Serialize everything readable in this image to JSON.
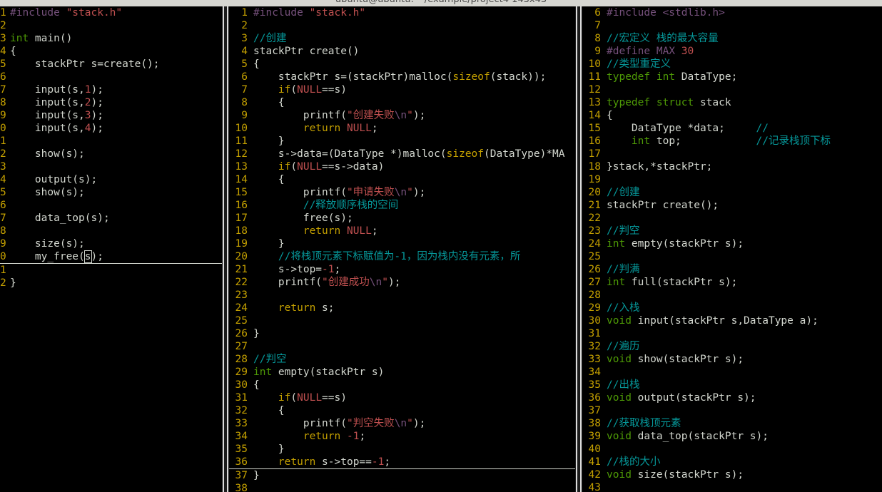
{
  "window": {
    "title": "ubuntu@ubuntu: ~/example/project4 143x43"
  },
  "panes": [
    {
      "id": "left",
      "lines": [
        {
          "n": "1",
          "segs": [
            [
              "pp",
              "#include "
            ],
            [
              "str",
              "\"stack.h\""
            ]
          ]
        },
        {
          "n": "2",
          "segs": []
        },
        {
          "n": "3",
          "segs": [
            [
              "ty",
              "int"
            ],
            [
              "",
              " main()"
            ]
          ]
        },
        {
          "n": "4",
          "segs": [
            [
              "",
              "{"
            ]
          ]
        },
        {
          "n": "5",
          "segs": [
            [
              "",
              "    stackPtr s=create();"
            ]
          ]
        },
        {
          "n": "6",
          "segs": []
        },
        {
          "n": "7",
          "segs": [
            [
              "",
              "    input(s,"
            ],
            [
              "num",
              "1"
            ],
            [
              "",
              ");"
            ]
          ]
        },
        {
          "n": "8",
          "segs": [
            [
              "",
              "    input(s,"
            ],
            [
              "num",
              "2"
            ],
            [
              "",
              ");"
            ]
          ]
        },
        {
          "n": "9",
          "segs": [
            [
              "",
              "    input(s,"
            ],
            [
              "num",
              "3"
            ],
            [
              "",
              ");"
            ]
          ]
        },
        {
          "n": "0",
          "segs": [
            [
              "",
              "    input(s,"
            ],
            [
              "num",
              "4"
            ],
            [
              "",
              ");"
            ]
          ]
        },
        {
          "n": "1",
          "segs": []
        },
        {
          "n": "2",
          "segs": [
            [
              "",
              "    show(s);"
            ]
          ]
        },
        {
          "n": "3",
          "segs": []
        },
        {
          "n": "4",
          "segs": [
            [
              "",
              "    output(s);"
            ]
          ]
        },
        {
          "n": "5",
          "segs": [
            [
              "",
              "    show(s);"
            ]
          ]
        },
        {
          "n": "6",
          "segs": []
        },
        {
          "n": "7",
          "segs": [
            [
              "",
              "    data_top(s);"
            ]
          ]
        },
        {
          "n": "8",
          "segs": []
        },
        {
          "n": "9",
          "segs": [
            [
              "",
              "    size(s);"
            ]
          ]
        },
        {
          "n": "0",
          "cursor": true,
          "segs": [
            [
              "",
              "    my_free("
            ],
            [
              "cur",
              "s"
            ],
            [
              "",
              ");"
            ]
          ]
        },
        {
          "n": "1",
          "segs": []
        },
        {
          "n": "2",
          "segs": [
            [
              "",
              "}"
            ]
          ]
        }
      ]
    },
    {
      "id": "mid",
      "lines": [
        {
          "n": "1",
          "segs": [
            [
              "pp",
              "#include "
            ],
            [
              "str",
              "\"stack.h\""
            ]
          ]
        },
        {
          "n": "2",
          "segs": []
        },
        {
          "n": "3",
          "segs": [
            [
              "cm",
              "//创建"
            ]
          ]
        },
        {
          "n": "4",
          "segs": [
            [
              "",
              "stackPtr create()"
            ]
          ]
        },
        {
          "n": "5",
          "segs": [
            [
              "",
              "{"
            ]
          ]
        },
        {
          "n": "6",
          "segs": [
            [
              "",
              "    stackPtr s=(stackPtr)malloc("
            ],
            [
              "kw",
              "sizeof"
            ],
            [
              "",
              "(stack));"
            ]
          ]
        },
        {
          "n": "7",
          "segs": [
            [
              "",
              "    "
            ],
            [
              "kw",
              "if"
            ],
            [
              "",
              "("
            ],
            [
              "num",
              "NULL"
            ],
            [
              "",
              "==s)"
            ]
          ]
        },
        {
          "n": "8",
          "segs": [
            [
              "",
              "    {"
            ]
          ]
        },
        {
          "n": "9",
          "segs": [
            [
              "",
              "        printf("
            ],
            [
              "str",
              "\"创建失败"
            ],
            [
              "pp",
              "\\n"
            ],
            [
              "str",
              "\""
            ],
            [
              "",
              ");"
            ]
          ]
        },
        {
          "n": "10",
          "segs": [
            [
              "",
              "        "
            ],
            [
              "kw",
              "return"
            ],
            [
              "",
              " "
            ],
            [
              "num",
              "NULL"
            ],
            [
              "",
              ";"
            ]
          ]
        },
        {
          "n": "11",
          "segs": [
            [
              "",
              "    }"
            ]
          ]
        },
        {
          "n": "12",
          "segs": [
            [
              "",
              "    s->data=(DataType *)malloc("
            ],
            [
              "kw",
              "sizeof"
            ],
            [
              "",
              "(DataType)*MA"
            ]
          ]
        },
        {
          "n": "13",
          "segs": [
            [
              "",
              "    "
            ],
            [
              "kw",
              "if"
            ],
            [
              "",
              "("
            ],
            [
              "num",
              "NULL"
            ],
            [
              "",
              "==s->data)"
            ]
          ]
        },
        {
          "n": "14",
          "segs": [
            [
              "",
              "    {"
            ]
          ]
        },
        {
          "n": "15",
          "segs": [
            [
              "",
              "        printf("
            ],
            [
              "str",
              "\"申请失败"
            ],
            [
              "pp",
              "\\n"
            ],
            [
              "str",
              "\""
            ],
            [
              "",
              ");"
            ]
          ]
        },
        {
          "n": "16",
          "segs": [
            [
              "",
              "        "
            ],
            [
              "cm",
              "//释放顺序栈的空间"
            ]
          ]
        },
        {
          "n": "17",
          "segs": [
            [
              "",
              "        free(s);"
            ]
          ]
        },
        {
          "n": "18",
          "segs": [
            [
              "",
              "        "
            ],
            [
              "kw",
              "return"
            ],
            [
              "",
              " "
            ],
            [
              "num",
              "NULL"
            ],
            [
              "",
              ";"
            ]
          ]
        },
        {
          "n": "19",
          "segs": [
            [
              "",
              "    }"
            ]
          ]
        },
        {
          "n": "20",
          "segs": [
            [
              "",
              "    "
            ],
            [
              "cm",
              "//将栈顶元素下标赋值为-1，因为栈内没有元素，所"
            ]
          ]
        },
        {
          "n": "21",
          "segs": [
            [
              "",
              "    s->top="
            ],
            [
              "num",
              "-1"
            ],
            [
              "",
              ";"
            ]
          ]
        },
        {
          "n": "22",
          "segs": [
            [
              "",
              "    printf("
            ],
            [
              "str",
              "\"创建成功"
            ],
            [
              "pp",
              "\\n"
            ],
            [
              "str",
              "\""
            ],
            [
              "",
              ");"
            ]
          ]
        },
        {
          "n": "23",
          "segs": []
        },
        {
          "n": "24",
          "segs": [
            [
              "",
              "    "
            ],
            [
              "kw",
              "return"
            ],
            [
              "",
              " s;"
            ]
          ]
        },
        {
          "n": "25",
          "segs": []
        },
        {
          "n": "26",
          "segs": [
            [
              "",
              "}"
            ]
          ]
        },
        {
          "n": "27",
          "segs": []
        },
        {
          "n": "28",
          "segs": [
            [
              "cm",
              "//判空"
            ]
          ]
        },
        {
          "n": "29",
          "segs": [
            [
              "ty",
              "int"
            ],
            [
              "",
              " empty(stackPtr s)"
            ]
          ]
        },
        {
          "n": "30",
          "segs": [
            [
              "",
              "{"
            ]
          ]
        },
        {
          "n": "31",
          "segs": [
            [
              "",
              "    "
            ],
            [
              "kw",
              "if"
            ],
            [
              "",
              "("
            ],
            [
              "num",
              "NULL"
            ],
            [
              "",
              "==s)"
            ]
          ]
        },
        {
          "n": "32",
          "segs": [
            [
              "",
              "    {"
            ]
          ]
        },
        {
          "n": "33",
          "segs": [
            [
              "",
              "        printf("
            ],
            [
              "str",
              "\"判空失败"
            ],
            [
              "pp",
              "\\n"
            ],
            [
              "str",
              "\""
            ],
            [
              "",
              ");"
            ]
          ]
        },
        {
          "n": "34",
          "segs": [
            [
              "",
              "        "
            ],
            [
              "kw",
              "return"
            ],
            [
              "",
              " "
            ],
            [
              "num",
              "-1"
            ],
            [
              "",
              ";"
            ]
          ]
        },
        {
          "n": "35",
          "segs": [
            [
              "",
              "    }"
            ]
          ]
        },
        {
          "n": "36",
          "cursor": true,
          "segs": [
            [
              "",
              "    "
            ],
            [
              "kw",
              "return"
            ],
            [
              "",
              " s->top=="
            ],
            [
              "num",
              "-1"
            ],
            [
              "",
              ";"
            ]
          ]
        },
        {
          "n": "37",
          "segs": [
            [
              "",
              "}"
            ]
          ]
        },
        {
          "n": "38",
          "segs": []
        }
      ]
    },
    {
      "id": "right",
      "lines": [
        {
          "n": "6",
          "segs": [
            [
              "pp",
              "#include <stdlib.h>"
            ]
          ]
        },
        {
          "n": "7",
          "segs": []
        },
        {
          "n": "8",
          "segs": [
            [
              "cm",
              "//宏定义 栈的最大容量"
            ]
          ]
        },
        {
          "n": "9",
          "segs": [
            [
              "pp",
              "#define MAX "
            ],
            [
              "num",
              "30"
            ]
          ]
        },
        {
          "n": "10",
          "segs": [
            [
              "cm",
              "//类型重定义"
            ]
          ]
        },
        {
          "n": "11",
          "segs": [
            [
              "ty",
              "typedef int"
            ],
            [
              "",
              " DataType;"
            ]
          ]
        },
        {
          "n": "12",
          "segs": []
        },
        {
          "n": "13",
          "segs": [
            [
              "ty",
              "typedef struct"
            ],
            [
              "",
              " stack"
            ]
          ]
        },
        {
          "n": "14",
          "segs": [
            [
              "",
              "{"
            ]
          ]
        },
        {
          "n": "15",
          "segs": [
            [
              "",
              "    DataType *data;     "
            ],
            [
              "cm",
              "//"
            ]
          ]
        },
        {
          "n": "16",
          "segs": [
            [
              "",
              "    "
            ],
            [
              "ty",
              "int"
            ],
            [
              "",
              " top;            "
            ],
            [
              "cm",
              "//记录栈顶下标"
            ]
          ]
        },
        {
          "n": "17",
          "segs": []
        },
        {
          "n": "18",
          "segs": [
            [
              "",
              "}stack,*stackPtr;"
            ]
          ]
        },
        {
          "n": "19",
          "segs": []
        },
        {
          "n": "20",
          "segs": [
            [
              "cm",
              "//创建"
            ]
          ]
        },
        {
          "n": "21",
          "segs": [
            [
              "",
              "stackPtr create();"
            ]
          ]
        },
        {
          "n": "22",
          "segs": []
        },
        {
          "n": "23",
          "segs": [
            [
              "cm",
              "//判空"
            ]
          ]
        },
        {
          "n": "24",
          "segs": [
            [
              "ty",
              "int"
            ],
            [
              "",
              " empty(stackPtr s);"
            ]
          ]
        },
        {
          "n": "25",
          "segs": []
        },
        {
          "n": "26",
          "segs": [
            [
              "cm",
              "//判满"
            ]
          ]
        },
        {
          "n": "27",
          "segs": [
            [
              "ty",
              "int"
            ],
            [
              "",
              " full(stackPtr s);"
            ]
          ]
        },
        {
          "n": "28",
          "segs": []
        },
        {
          "n": "29",
          "segs": [
            [
              "cm",
              "//入栈"
            ]
          ]
        },
        {
          "n": "30",
          "segs": [
            [
              "ty",
              "void"
            ],
            [
              "",
              " input(stackPtr s,DataType a);"
            ]
          ]
        },
        {
          "n": "31",
          "segs": []
        },
        {
          "n": "32",
          "segs": [
            [
              "cm",
              "//遍历"
            ]
          ]
        },
        {
          "n": "33",
          "segs": [
            [
              "ty",
              "void"
            ],
            [
              "",
              " show(stackPtr s);"
            ]
          ]
        },
        {
          "n": "34",
          "segs": []
        },
        {
          "n": "35",
          "segs": [
            [
              "cm",
              "//出栈"
            ]
          ]
        },
        {
          "n": "36",
          "segs": [
            [
              "ty",
              "void"
            ],
            [
              "",
              " output(stackPtr s);"
            ]
          ]
        },
        {
          "n": "37",
          "segs": []
        },
        {
          "n": "38",
          "segs": [
            [
              "cm",
              "//获取栈顶元素"
            ]
          ]
        },
        {
          "n": "39",
          "segs": [
            [
              "ty",
              "void"
            ],
            [
              "",
              " data_top(stackPtr s);"
            ]
          ]
        },
        {
          "n": "40",
          "segs": []
        },
        {
          "n": "41",
          "segs": [
            [
              "cm",
              "//栈的大小"
            ]
          ]
        },
        {
          "n": "42",
          "segs": [
            [
              "ty",
              "void"
            ],
            [
              "",
              " size(stackPtr s);"
            ]
          ]
        },
        {
          "n": "43",
          "segs": []
        }
      ]
    }
  ]
}
